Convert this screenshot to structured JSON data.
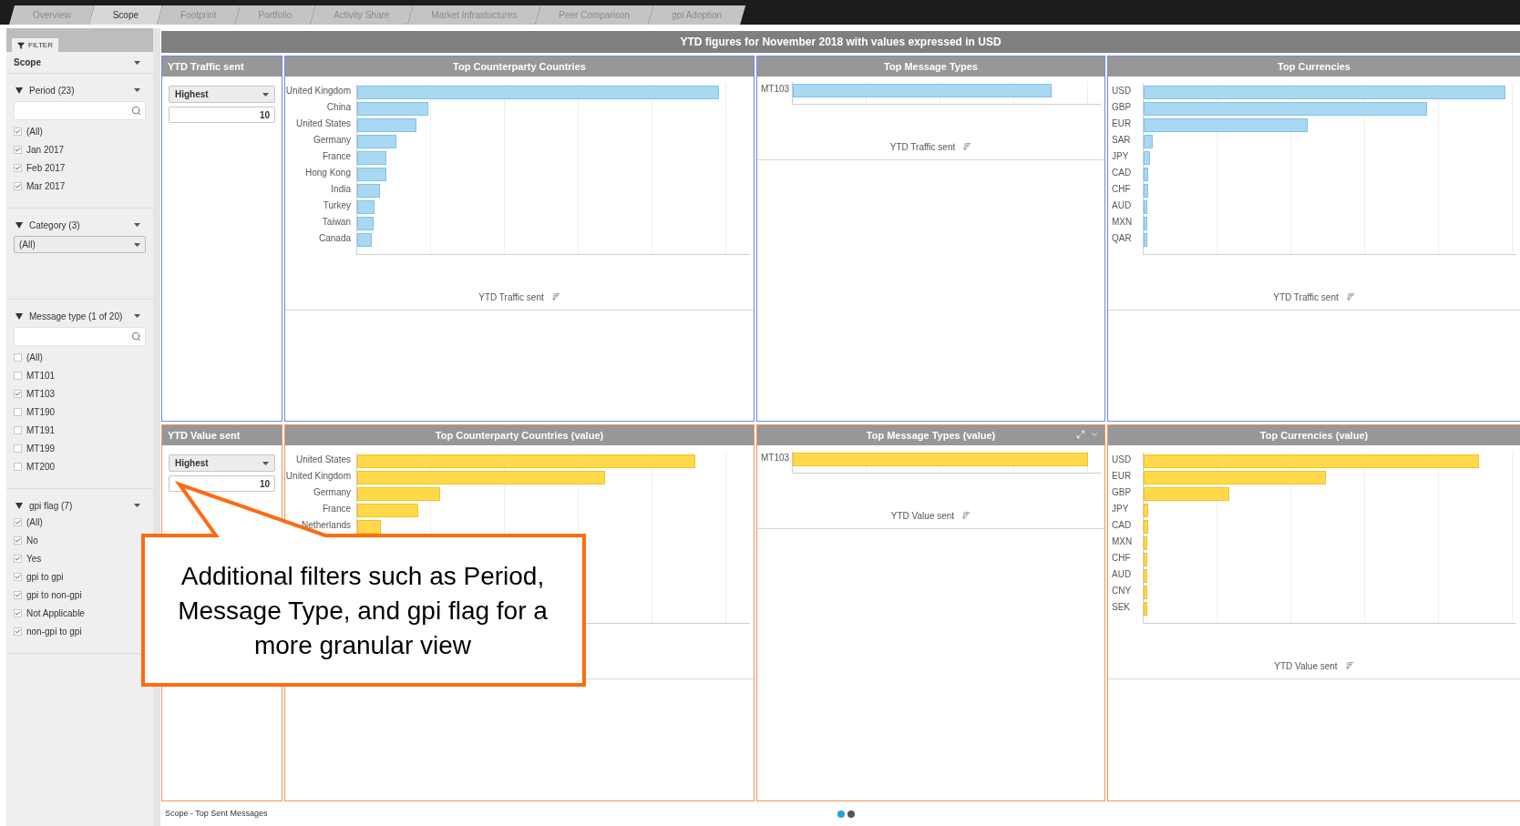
{
  "tabs": [
    {
      "label": "Overview",
      "selected": false
    },
    {
      "label": "Scope",
      "selected": true
    },
    {
      "label": "Footprint",
      "selected": false
    },
    {
      "label": "Portfolio",
      "selected": false
    },
    {
      "label": "Activity Share",
      "selected": false
    },
    {
      "label": "Market Infrastuctures",
      "selected": false
    },
    {
      "label": "Peer Comparison",
      "selected": false
    },
    {
      "label": "gpi Adoption",
      "selected": false
    }
  ],
  "sidebar": {
    "filter_tab": "FILTER",
    "scope": "Scope",
    "groups": [
      {
        "kind": "list",
        "title": "Period (23)",
        "search": true,
        "items": [
          {
            "label": "(All)",
            "checked": true
          },
          {
            "label": "Jan 2017",
            "checked": true
          },
          {
            "label": "Feb 2017",
            "checked": true
          },
          {
            "label": "Mar 2017",
            "checked": true
          }
        ]
      },
      {
        "kind": "dropdown",
        "title": "Category (3)",
        "value": "(All)"
      },
      {
        "kind": "list",
        "title": "Message type (1 of 20)",
        "search": true,
        "items": [
          {
            "label": "(All)",
            "checked": false
          },
          {
            "label": "MT101",
            "checked": false
          },
          {
            "label": "MT103",
            "checked": true
          },
          {
            "label": "MT190",
            "checked": false
          },
          {
            "label": "MT191",
            "checked": false
          },
          {
            "label": "MT199",
            "checked": false
          },
          {
            "label": "MT200",
            "checked": false
          }
        ]
      },
      {
        "kind": "list",
        "title": "gpi flag (7)",
        "search": false,
        "items": [
          {
            "label": "(All)",
            "checked": true
          },
          {
            "label": "No",
            "checked": true
          },
          {
            "label": "Yes",
            "checked": true
          },
          {
            "label": "gpi to gpi",
            "checked": true
          },
          {
            "label": "gpi to non-gpi",
            "checked": true
          },
          {
            "label": "Not Applicable",
            "checked": true
          },
          {
            "label": "non-gpi to gpi",
            "checked": true
          }
        ]
      }
    ]
  },
  "header": "YTD figures for November 2018 with values expressed in USD",
  "rows": [
    {
      "kind": "traffic",
      "panels": [
        {
          "kind": "selector",
          "title": "YTD Traffic sent",
          "select": "Highest",
          "count": "10"
        },
        {
          "kind": "bars",
          "title": "Top Counterparty Countries",
          "axis_label": "YTD Traffic sent",
          "tools": false,
          "bars": [
            {
              "label": "United Kingdom",
              "level": 0.92
            },
            {
              "label": "China",
              "level": 0.18
            },
            {
              "label": "United States",
              "level": 0.15
            },
            {
              "label": "Germany",
              "level": 0.1
            },
            {
              "label": "France",
              "level": 0.075
            },
            {
              "label": "Hong Kong",
              "level": 0.075
            },
            {
              "label": "India",
              "level": 0.057
            },
            {
              "label": "Turkey",
              "level": 0.045
            },
            {
              "label": "Taiwan",
              "level": 0.042
            },
            {
              "label": "Canada",
              "level": 0.038
            }
          ]
        },
        {
          "kind": "bars",
          "title": "Top Message Types",
          "axis_label": "YTD Traffic sent",
          "tools": false,
          "bars": [
            {
              "label": "MT103",
              "level": 0.84
            }
          ]
        },
        {
          "kind": "bars",
          "title": "Top Currencies",
          "axis_label": "YTD Traffic sent",
          "tools": false,
          "bars": [
            {
              "label": "USD",
              "level": 0.97
            },
            {
              "label": "GBP",
              "level": 0.76
            },
            {
              "label": "EUR",
              "level": 0.44
            },
            {
              "label": "SAR",
              "level": 0.025
            },
            {
              "label": "JPY",
              "level": 0.016
            },
            {
              "label": "CAD",
              "level": 0.013
            },
            {
              "label": "CHF",
              "level": 0.013
            },
            {
              "label": "AUD",
              "level": 0.011
            },
            {
              "label": "MXN",
              "level": 0.011
            },
            {
              "label": "QAR",
              "level": 0.009
            }
          ]
        }
      ]
    },
    {
      "kind": "value",
      "panels": [
        {
          "kind": "selector",
          "title": "YTD Value sent",
          "select": "Highest",
          "count": "10"
        },
        {
          "kind": "bars",
          "title": "Top Counterparty Countries (value)",
          "tools": false,
          "bars": [
            {
              "label": "United States",
              "level": 0.86
            },
            {
              "label": "United Kingdom",
              "level": 0.63
            },
            {
              "label": "Germany",
              "level": 0.21
            },
            {
              "label": "France",
              "level": 0.155
            },
            {
              "label": "Netherlands",
              "level": 0.06
            }
          ]
        },
        {
          "kind": "bars",
          "title": "Top Message Types (value)",
          "axis_label": "YTD Value sent",
          "tools": true,
          "bars": [
            {
              "label": "MT103",
              "level": 0.96
            }
          ]
        },
        {
          "kind": "bars",
          "title": "Top Currencies (value)",
          "axis_label": "YTD Value sent",
          "tools": false,
          "bars": [
            {
              "label": "USD",
              "level": 0.9
            },
            {
              "label": "EUR",
              "level": 0.49
            },
            {
              "label": "GBP",
              "level": 0.23
            },
            {
              "label": "JPY",
              "level": 0.013
            },
            {
              "label": "CAD",
              "level": 0.013
            },
            {
              "label": "MXN",
              "level": 0.011
            },
            {
              "label": "CHF",
              "level": 0.011
            },
            {
              "label": "AUD",
              "level": 0.01
            },
            {
              "label": "CNY",
              "level": 0.009
            },
            {
              "label": "SEK",
              "level": 0.009
            }
          ]
        }
      ]
    }
  ],
  "status": "Scope - Top Sent Messages",
  "pages": [
    {
      "selected": true
    },
    {
      "selected": false
    }
  ],
  "callout": "Additional filters such as Period, Message Type, and gpi flag for a more granular view"
}
